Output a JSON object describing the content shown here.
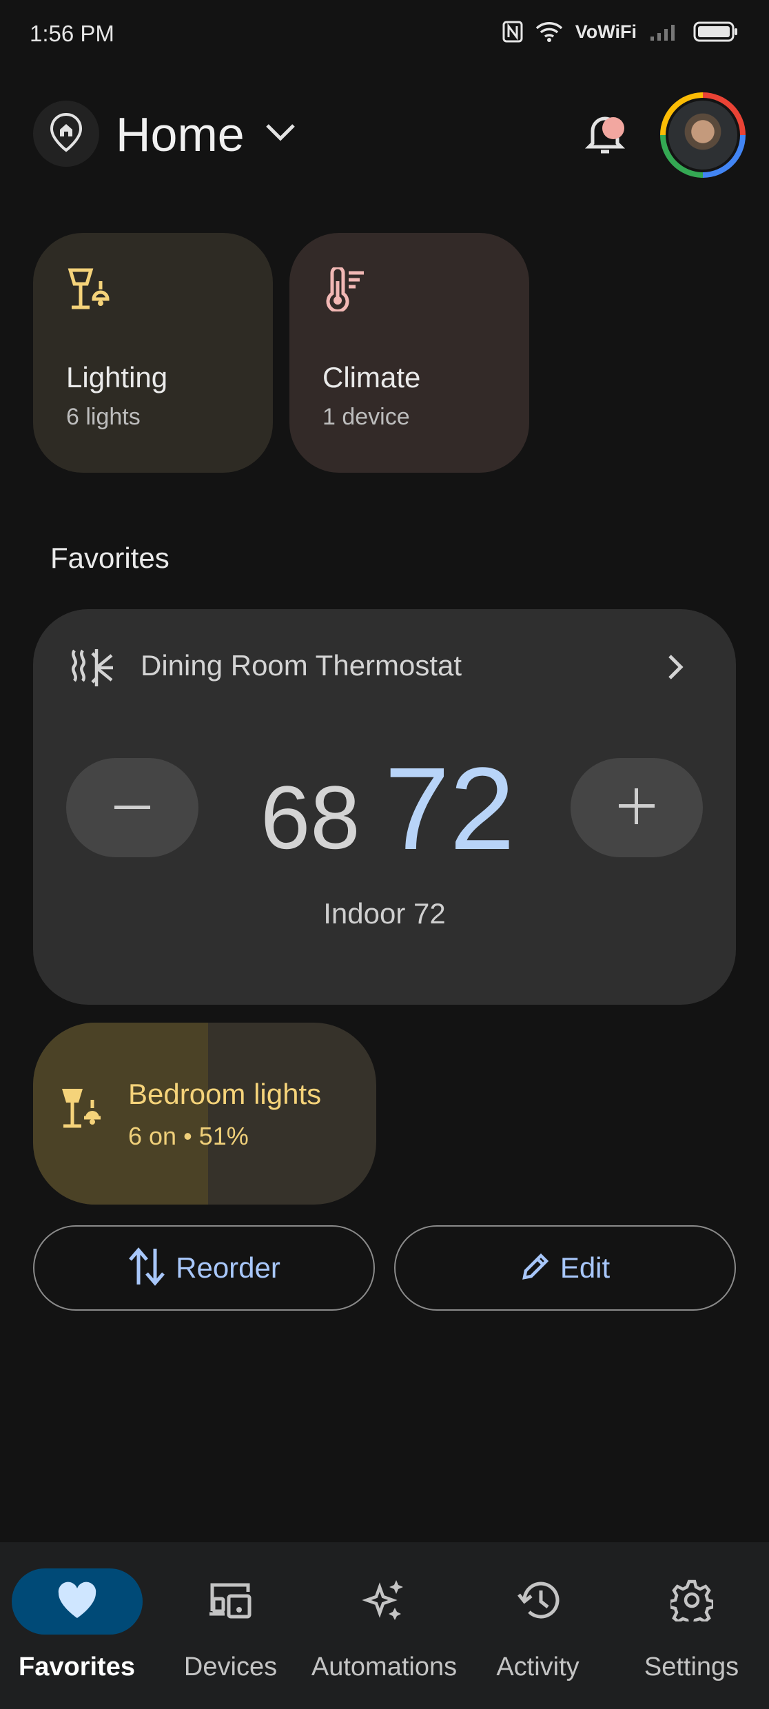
{
  "status_bar": {
    "time": "1:56 PM",
    "network": "VoWiFi"
  },
  "header": {
    "home_name": "Home"
  },
  "categories": [
    {
      "title": "Lighting",
      "subtitle": "6 lights",
      "icon": "lamp-icon",
      "color": "#f5d37a"
    },
    {
      "title": "Climate",
      "subtitle": "1 device",
      "icon": "thermometer-icon",
      "color": "#f2b8b5"
    }
  ],
  "favorites": {
    "heading": "Favorites",
    "thermostat": {
      "name": "Dining Room Thermostat",
      "heat_setpoint": "68",
      "cool_setpoint": "72",
      "indoor_label": "Indoor 72",
      "cool_color": "#b8d4f8"
    },
    "lights": {
      "name": "Bedroom lights",
      "status": "6 on • 51%",
      "brightness_percent": 51,
      "color": "#f5d37a"
    },
    "reorder_label": "Reorder",
    "edit_label": "Edit"
  },
  "nav": {
    "items": [
      {
        "label": "Favorites",
        "icon": "heart-icon",
        "active": true
      },
      {
        "label": "Devices",
        "icon": "devices-icon",
        "active": false
      },
      {
        "label": "Automations",
        "icon": "sparkle-icon",
        "active": false
      },
      {
        "label": "Activity",
        "icon": "history-icon",
        "active": false
      },
      {
        "label": "Settings",
        "icon": "gear-icon",
        "active": false
      }
    ]
  },
  "colors": {
    "accent": "#a8c7fa",
    "active_nav_bg": "#004a77",
    "background": "#131313"
  }
}
